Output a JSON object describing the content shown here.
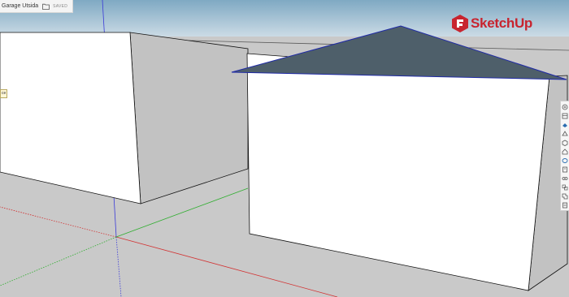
{
  "document": {
    "title": "Garage Utsida",
    "status": "SAVED"
  },
  "brand": {
    "name": "SketchUp",
    "logo_color": "#c8242f"
  },
  "scene_tag": {
    "text": "ce"
  },
  "colors": {
    "sky_top": "#7fa9c3",
    "sky_bottom": "#e8eef2",
    "ground": "#c9c9c9",
    "wall_front": "#ffffff",
    "wall_side": "#c2c2c2",
    "roof": "#4e5f6a",
    "roof_edge": "#1f2aa6",
    "axis_red": "#d23232",
    "axis_green": "#2fae2f",
    "axis_blue": "#3a3ad8"
  },
  "right_toolbar": {
    "tools": [
      {
        "icon": "entity-info-icon"
      },
      {
        "icon": "instructor-icon"
      },
      {
        "icon": "components-icon"
      },
      {
        "icon": "materials-icon"
      },
      {
        "icon": "styles-icon"
      },
      {
        "icon": "tags-icon"
      },
      {
        "icon": "scenes-icon"
      },
      {
        "icon": "shadows-icon"
      },
      {
        "icon": "display-icon"
      },
      {
        "icon": "outliner-icon"
      },
      {
        "icon": "solid-tools-icon"
      },
      {
        "icon": "report-icon"
      }
    ]
  }
}
